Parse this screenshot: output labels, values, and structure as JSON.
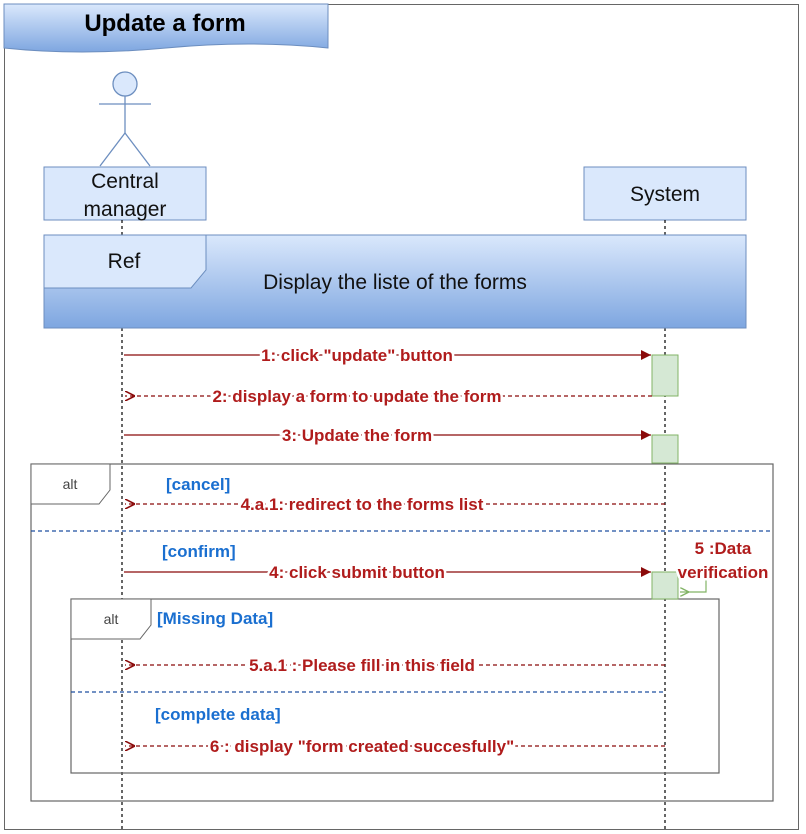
{
  "diagram": {
    "title": "Update a form",
    "lifelines": {
      "actor": {
        "line1": "Central",
        "line2": "manager"
      },
      "system": {
        "label": "System"
      }
    },
    "ref": {
      "tag": "Ref",
      "text": "Display the liste of the forms"
    },
    "messages": {
      "m1": "1: click \"update\" button",
      "m2": "2: display a form to update the form",
      "m3": "3: Update the form",
      "m4a1": "4.a.1: redirect to the forms list",
      "m4": "4: click submit button",
      "m5_line1": "5 :Data",
      "m5_line2": "verification",
      "m5a1": "5.a.1 : Please fill in this field",
      "m6": "6 : display \"form created succesfully\""
    },
    "fragments": {
      "outer": {
        "operator": "alt",
        "guard1": "[cancel]",
        "guard2": "[confirm]"
      },
      "inner": {
        "operator": "alt",
        "guard1": "[Missing Data]",
        "guard2": "[complete data]"
      }
    }
  },
  "colors": {
    "message": "#b01c1c",
    "guard": "#1a6fd0",
    "box_fill": "#dae8fc",
    "box_stroke": "#6c8ebf",
    "activation_fill": "#d5e8d4",
    "activation_stroke": "#82b366"
  }
}
